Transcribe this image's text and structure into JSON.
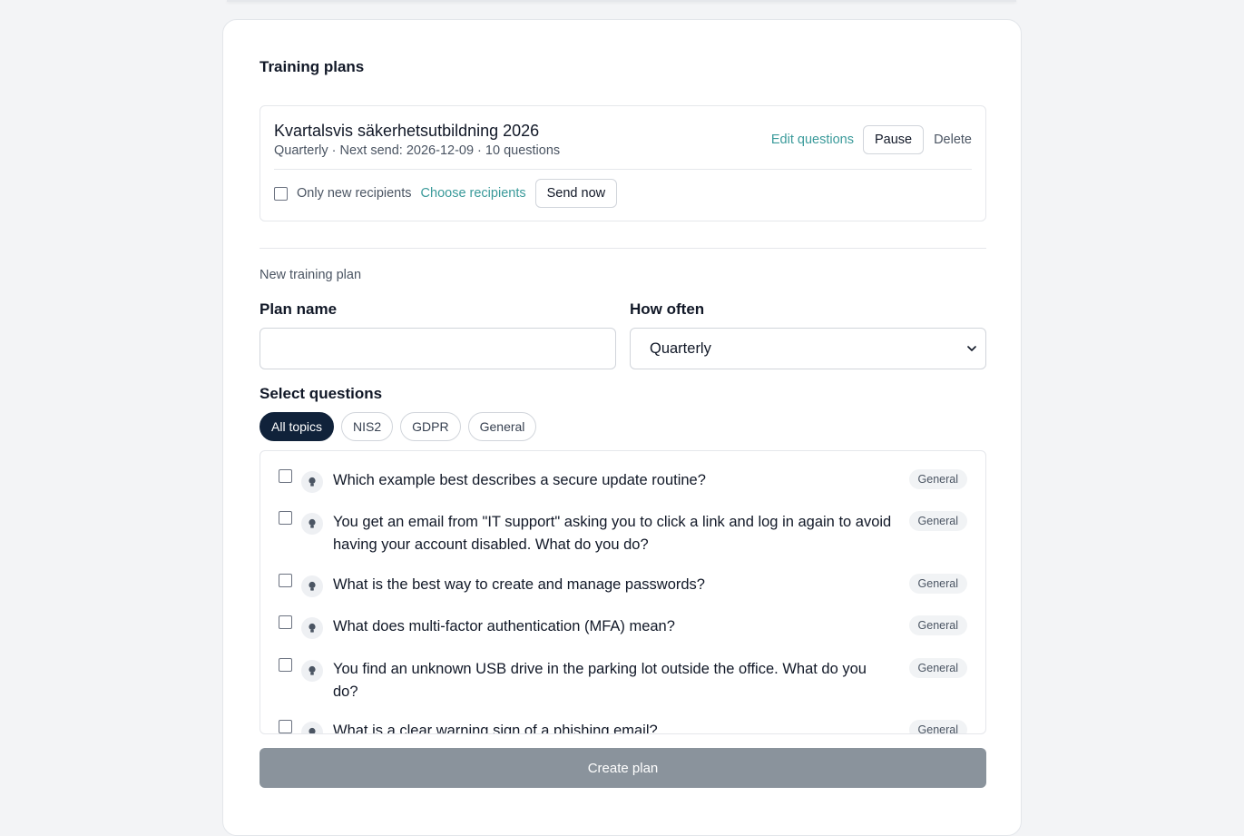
{
  "section_title": "Training plans",
  "plan": {
    "name": "Kvartalsvis säkerhetsutbildning 2026",
    "meta": "Quarterly · Next send: 2026-12-09 · 10 questions",
    "edit_label": "Edit questions",
    "pause_label": "Pause",
    "delete_label": "Delete",
    "only_new_label": "Only new recipients",
    "choose_recipients_label": "Choose recipients",
    "send_now_label": "Send now"
  },
  "new_plan": {
    "subheading": "New training plan",
    "plan_name_label": "Plan name",
    "plan_name_value": "",
    "how_often_label": "How often",
    "how_often_value": "Quarterly",
    "select_questions_label": "Select questions",
    "topics": [
      "All topics",
      "NIS2",
      "GDPR",
      "General"
    ],
    "active_topic": "All topics",
    "questions": [
      {
        "text": "Which example best describes a secure update routine?",
        "tag": "General"
      },
      {
        "text": "You get an email from \"IT support\" asking you to click a link and log in again to avoid having your account disabled. What do you do?",
        "tag": "General"
      },
      {
        "text": "What is the best way to create and manage passwords?",
        "tag": "General"
      },
      {
        "text": "What does multi-factor authentication (MFA) mean?",
        "tag": "General"
      },
      {
        "text": "You find an unknown USB drive in the parking lot outside the office. What do you do?",
        "tag": "General"
      },
      {
        "text": "What is a clear warning sign of a phishing email?",
        "tag": "General"
      }
    ],
    "create_label": "Create plan"
  },
  "colors": {
    "accent_link": "#3a9a9a",
    "active_pill": "#10223a",
    "disabled_button": "#8a939c"
  },
  "icons": {
    "question_icon": "lightbulb-icon",
    "select_icon": "chevron-down-icon"
  }
}
